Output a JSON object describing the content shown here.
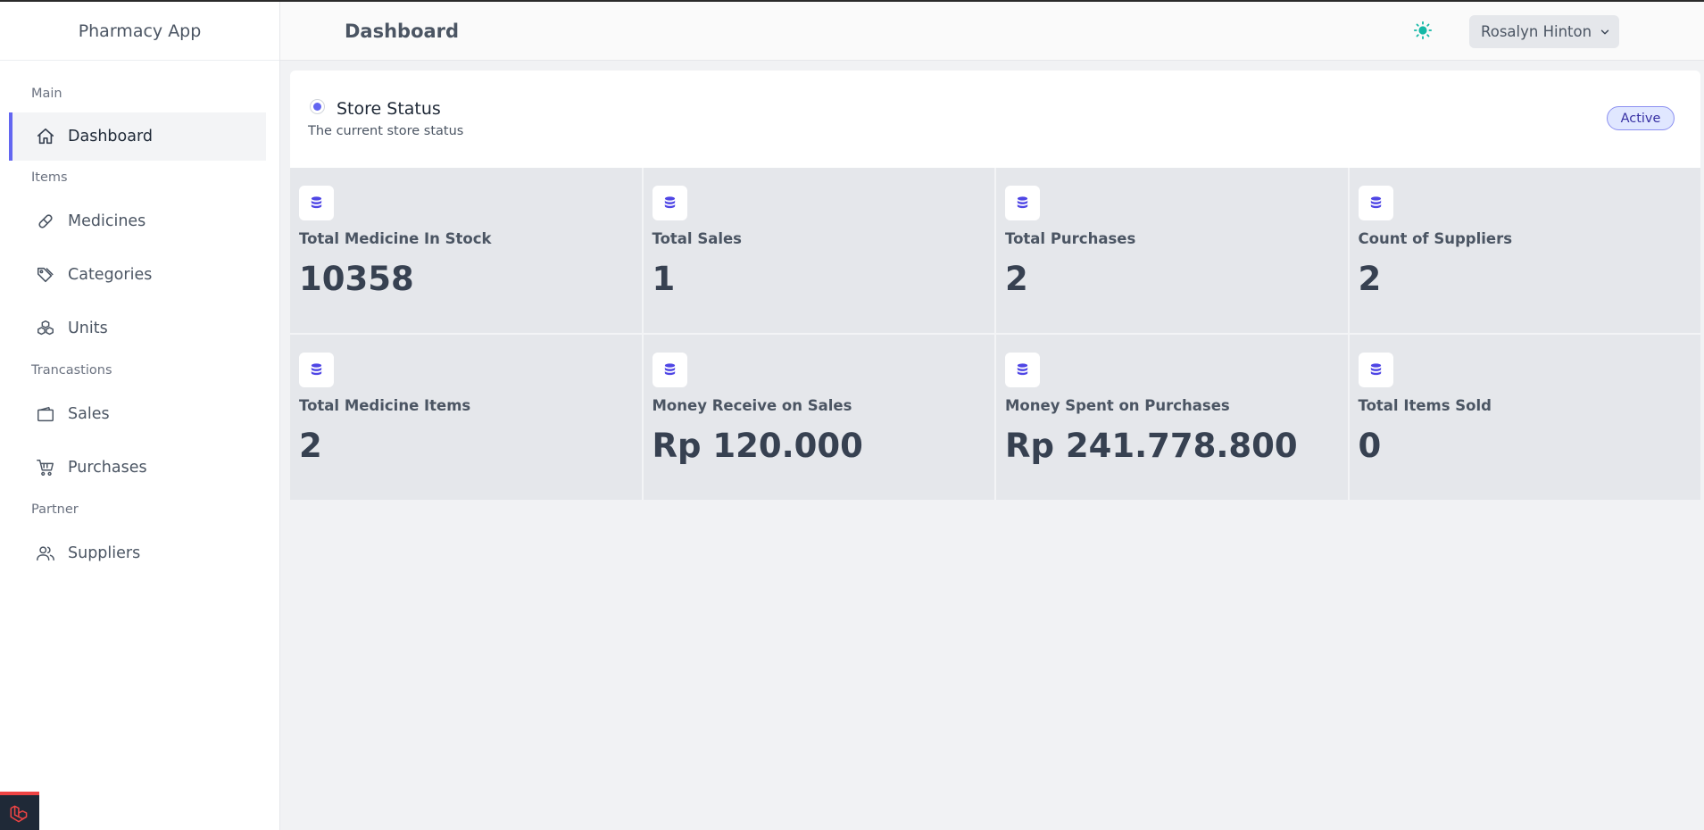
{
  "app": {
    "name": "Pharmacy App"
  },
  "header": {
    "title": "Dashboard",
    "user_name": "Rosalyn Hinton",
    "theme_icon": "sun-icon"
  },
  "sidebar": {
    "sections": [
      {
        "label": "Main",
        "items": [
          {
            "label": "Dashboard",
            "icon": "home-icon",
            "active": true
          }
        ]
      },
      {
        "label": "Items",
        "items": [
          {
            "label": "Medicines",
            "icon": "pill-icon"
          },
          {
            "label": "Categories",
            "icon": "tags-icon"
          },
          {
            "label": "Units",
            "icon": "cubes-icon"
          }
        ]
      },
      {
        "label": "Trancastions",
        "items": [
          {
            "label": "Sales",
            "icon": "wallet-icon"
          },
          {
            "label": "Purchases",
            "icon": "cart-icon"
          }
        ]
      },
      {
        "label": "Partner",
        "items": [
          {
            "label": "Suppliers",
            "icon": "users-icon"
          }
        ]
      }
    ]
  },
  "store_status": {
    "title": "Store Status",
    "subtitle": "The current store status",
    "badge": "Active"
  },
  "stats": [
    {
      "label": "Total Medicine In Stock",
      "value": "10358",
      "icon": "database-icon"
    },
    {
      "label": "Total Sales",
      "value": "1",
      "icon": "database-icon"
    },
    {
      "label": "Total Purchases",
      "value": "2",
      "icon": "database-icon"
    },
    {
      "label": "Count of Suppliers",
      "value": "2",
      "icon": "database-icon"
    },
    {
      "label": "Total Medicine Items",
      "value": "2",
      "icon": "database-icon"
    },
    {
      "label": "Money Receive on Sales",
      "value": "Rp 120.000",
      "icon": "database-icon"
    },
    {
      "label": "Money Spent on Purchases",
      "value": "Rp 241.778.800",
      "icon": "database-icon"
    },
    {
      "label": "Total Items Sold",
      "value": "0",
      "icon": "database-icon"
    }
  ],
  "colors": {
    "accent": "#6366f1",
    "theme_icon": "#14b8a6",
    "badge_bg": "#e0e7ff",
    "card_bg": "#e5e7eb"
  }
}
